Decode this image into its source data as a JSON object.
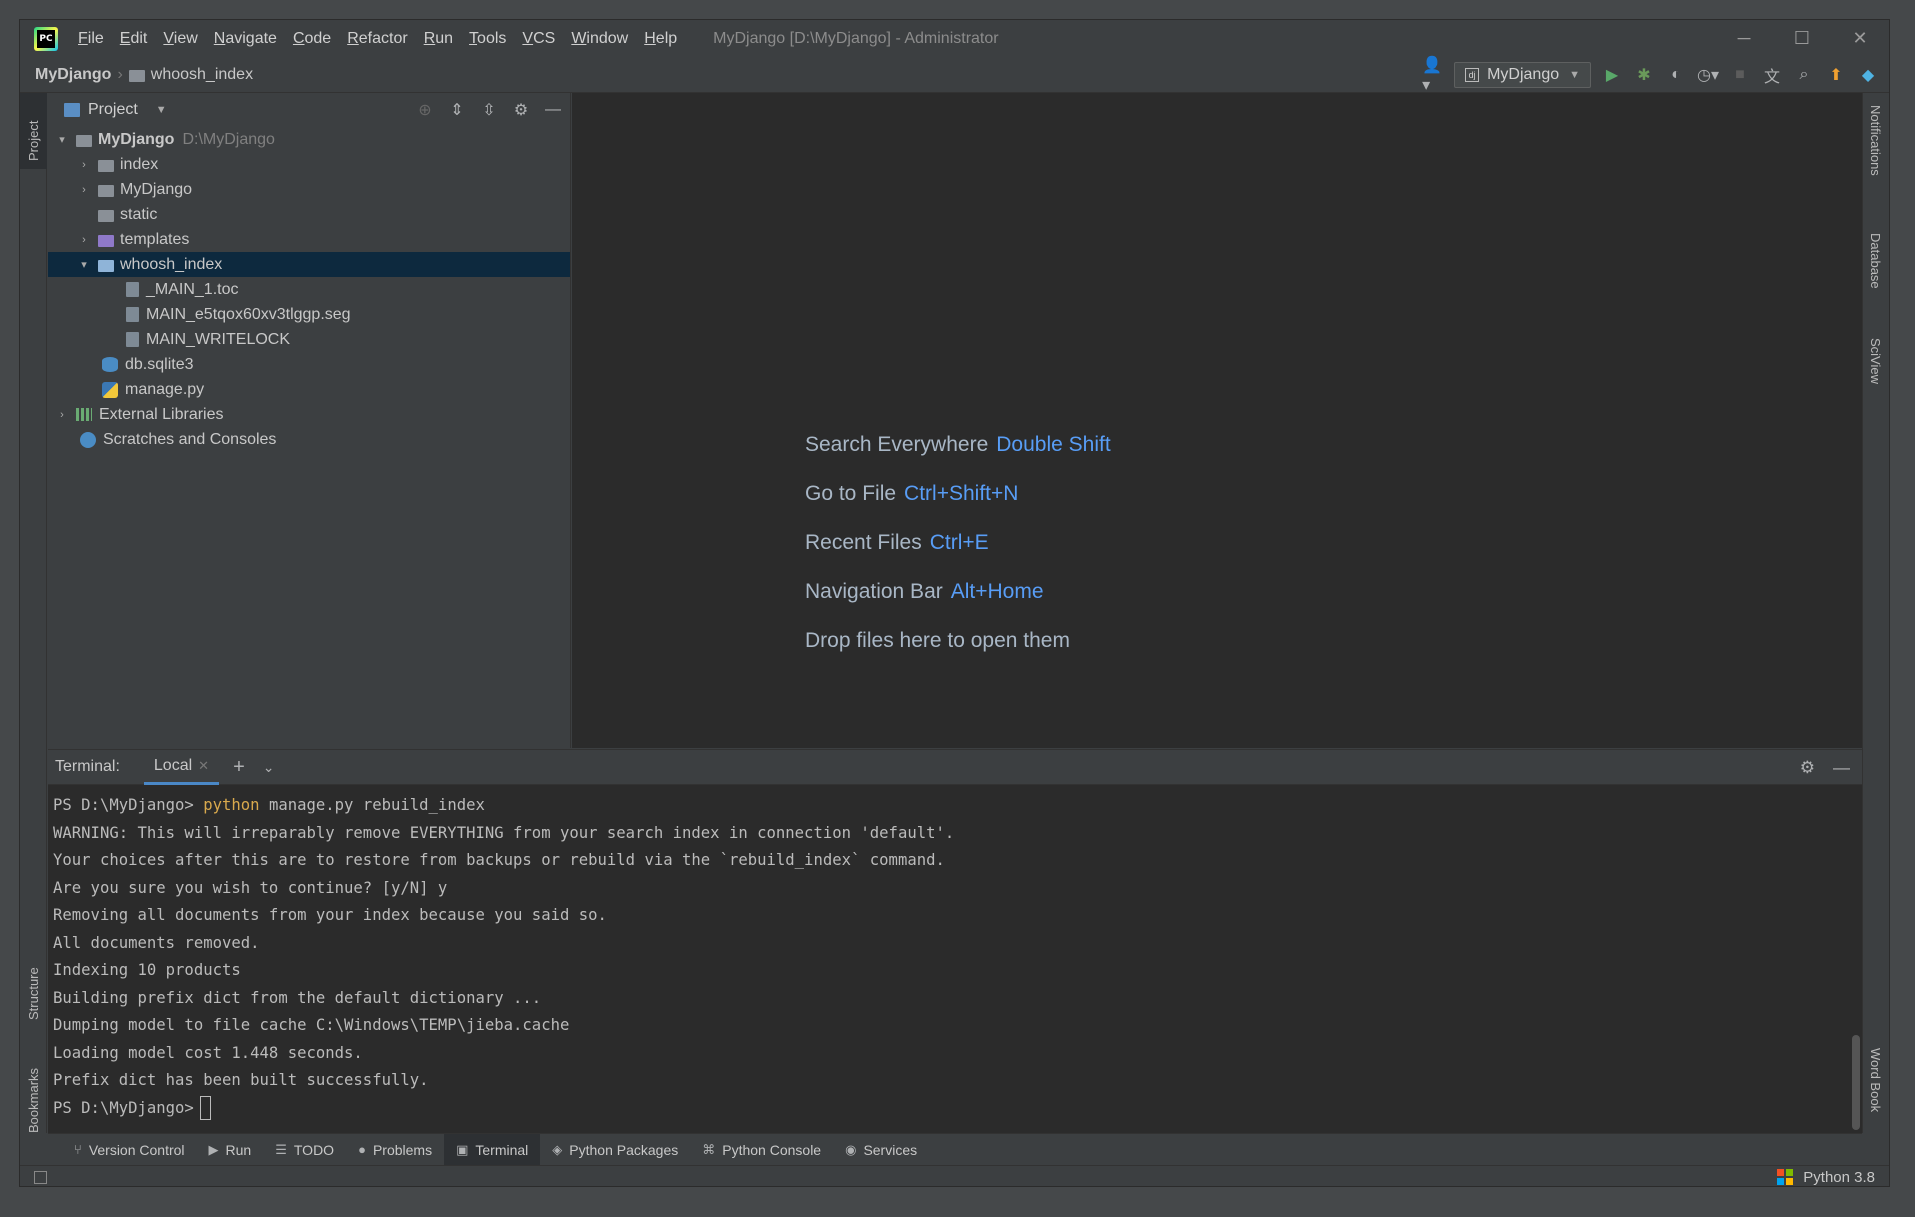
{
  "window": {
    "title": "MyDjango [D:\\MyDjango] - Administrator",
    "menu": [
      "File",
      "Edit",
      "View",
      "Navigate",
      "Code",
      "Refactor",
      "Run",
      "Tools",
      "VCS",
      "Window",
      "Help"
    ],
    "controls": [
      "─",
      "☐",
      "✕"
    ]
  },
  "navbar": {
    "project": "MyDjango",
    "folder": "whoosh_index",
    "run_config": "MyDjango"
  },
  "left_stripe": {
    "project": "Project",
    "structure": "Structure",
    "bookmarks": "Bookmarks"
  },
  "right_stripe": {
    "notifications": "Notifications",
    "database": "Database",
    "sciview": "SciView",
    "wordbook": "Word Book"
  },
  "project_panel": {
    "title": "Project",
    "tree": {
      "root": "MyDjango",
      "root_path": "D:\\MyDjango",
      "index": "index",
      "mydjango": "MyDjango",
      "static": "static",
      "templates": "templates",
      "whoosh_index": "whoosh_index",
      "toc": "_MAIN_1.toc",
      "seg": "MAIN_e5tqox60xv3tlggp.seg",
      "writelock": "MAIN_WRITELOCK",
      "db": "db.sqlite3",
      "manage": "manage.py",
      "external": "External Libraries",
      "scratches": "Scratches and Consoles"
    }
  },
  "editor_hints": [
    {
      "label": "Search Everywhere",
      "key": "Double Shift"
    },
    {
      "label": "Go to File",
      "key": "Ctrl+Shift+N"
    },
    {
      "label": "Recent Files",
      "key": "Ctrl+E"
    },
    {
      "label": "Navigation Bar",
      "key": "Alt+Home"
    },
    {
      "label": "Drop files here to open them",
      "key": ""
    }
  ],
  "terminal": {
    "label": "Terminal:",
    "tab": "Local",
    "prompt": "PS D:\\MyDjango> ",
    "cmd_word": "python",
    "cmd_rest": " manage.py rebuild_index",
    "lines": [
      "WARNING: This will irreparably remove EVERYTHING from your search index in connection 'default'.",
      "Your choices after this are to restore from backups or rebuild via the `rebuild_index` command.",
      "Are you sure you wish to continue? [y/N] y",
      "Removing all documents from your index because you said so.",
      "All documents removed.",
      "Indexing 10 products",
      "Building prefix dict from the default dictionary ...",
      "Dumping model to file cache C:\\Windows\\TEMP\\jieba.cache",
      "Loading model cost 1.448 seconds.",
      "Prefix dict has been built successfully."
    ],
    "final_prompt": "PS D:\\MyDjango>"
  },
  "bottom_tabs": [
    "Version Control",
    "Run",
    "TODO",
    "Problems",
    "Terminal",
    "Python Packages",
    "Python Console",
    "Services"
  ],
  "status": {
    "interpreter": "Python 3.8"
  }
}
